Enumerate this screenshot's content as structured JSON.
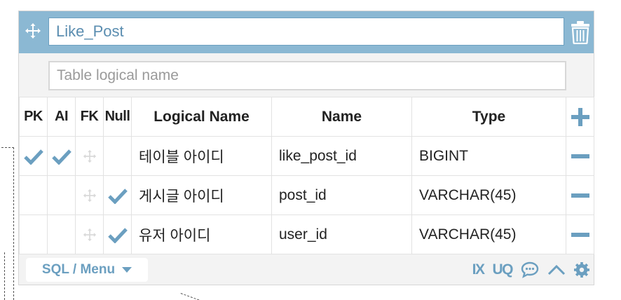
{
  "colors": {
    "accent": "#6b9fc0",
    "header_bg": "#8bb8d3",
    "card_bg": "#f3f3f3",
    "icon": "#6b9fc0"
  },
  "table": {
    "name": "Like_Post",
    "logical_name_placeholder": "Table logical name"
  },
  "columns_header": {
    "pk": "PK",
    "ai": "AI",
    "fk": "FK",
    "null": "Null",
    "logical_name": "Logical Name",
    "name": "Name",
    "type": "Type"
  },
  "rows": [
    {
      "pk": true,
      "ai": true,
      "fk": false,
      "null": false,
      "logical_name": "테이블 아이디",
      "name": "like_post_id",
      "type": "BIGINT"
    },
    {
      "pk": false,
      "ai": false,
      "fk": false,
      "null": true,
      "logical_name": "게시글 아이디",
      "name": "post_id",
      "type": "VARCHAR(45)"
    },
    {
      "pk": false,
      "ai": false,
      "fk": false,
      "null": true,
      "logical_name": "유저 아이디",
      "name": "user_id",
      "type": "VARCHAR(45)"
    }
  ],
  "footer": {
    "sql_menu_label": "SQL / Menu",
    "index_label": "IX",
    "unique_label": "UQ"
  },
  "icons": {
    "move": "move-arrows-icon",
    "delete": "trash-icon",
    "add": "plus-icon",
    "remove": "minus-icon",
    "check": "check-icon",
    "fk_handle": "move-arrows-icon",
    "comment": "comment-icon",
    "collapse": "chevron-up-icon",
    "settings": "gear-icon",
    "dropdown": "caret-down-icon"
  }
}
